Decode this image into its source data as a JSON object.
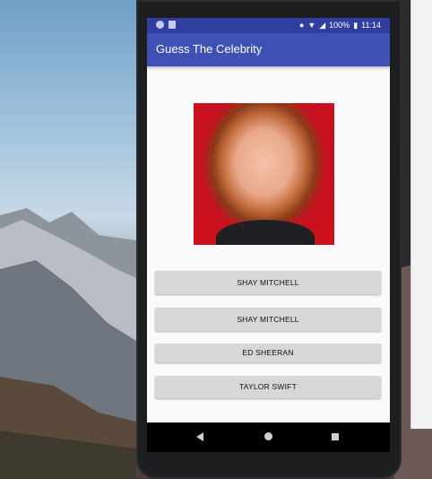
{
  "status_bar": {
    "battery": "100%",
    "time": "11:14"
  },
  "app": {
    "title": "Guess The Celebrity"
  },
  "answers": [
    "SHAY MITCHELL",
    "SHAY MITCHELL",
    "ED SHEERAN",
    "TAYLOR SWIFT"
  ],
  "colors": {
    "primary": "#3f51b5",
    "primary_dark": "#303f9f",
    "button": "#d6d7d7"
  }
}
